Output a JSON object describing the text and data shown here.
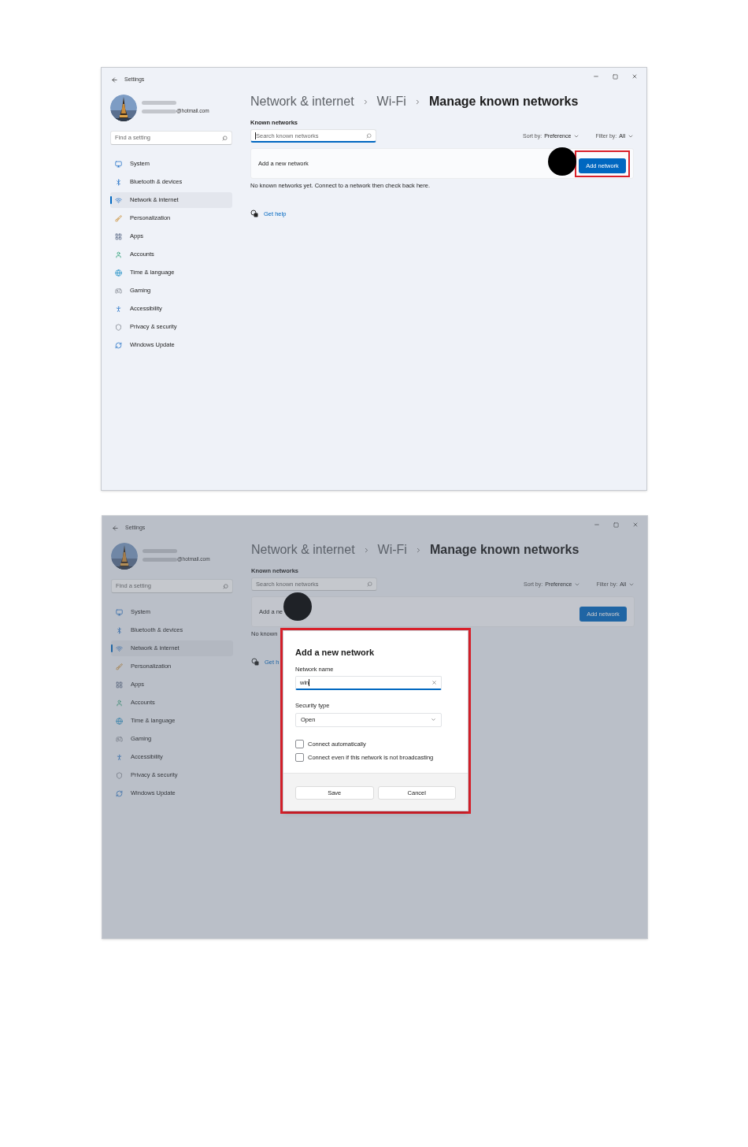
{
  "screenshots": [
    {
      "window": {
        "title": "Settings"
      },
      "account": {
        "email": "@hotmail.com"
      },
      "find_setting": {
        "placeholder": "Find a setting"
      },
      "nav": [
        {
          "label": "System",
          "selected": false
        },
        {
          "label": "Bluetooth & devices",
          "selected": false
        },
        {
          "label": "Network & internet",
          "selected": true
        },
        {
          "label": "Personalization",
          "selected": false
        },
        {
          "label": "Apps",
          "selected": false
        },
        {
          "label": "Accounts",
          "selected": false
        },
        {
          "label": "Time & language",
          "selected": false
        },
        {
          "label": "Gaming",
          "selected": false
        },
        {
          "label": "Accessibility",
          "selected": false
        },
        {
          "label": "Privacy & security",
          "selected": false
        },
        {
          "label": "Windows Update",
          "selected": false
        }
      ],
      "breadcrumb": [
        "Network & internet",
        "Wi-Fi",
        "Manage known networks"
      ],
      "section_title": "Known networks",
      "network_search": {
        "placeholder": "Search known networks",
        "focused": true
      },
      "sort": {
        "label": "Sort by:",
        "value": "Preference"
      },
      "filter": {
        "label": "Filter by:",
        "value": "All"
      },
      "add_row": {
        "label": "Add a new network",
        "button": "Add network",
        "button_highlighted": true,
        "button_marker": true
      },
      "empty_message": "No known networks yet. Connect to a network then check back here.",
      "help_link": "Get help",
      "dimmed": false
    },
    {
      "window": {
        "title": "Settings"
      },
      "account": {
        "email": "@hotmail.com"
      },
      "find_setting": {
        "placeholder": "Find a setting"
      },
      "nav": [
        {
          "label": "System",
          "selected": false
        },
        {
          "label": "Bluetooth & devices",
          "selected": false
        },
        {
          "label": "Network & internet",
          "selected": true
        },
        {
          "label": "Personalization",
          "selected": false
        },
        {
          "label": "Apps",
          "selected": false
        },
        {
          "label": "Accounts",
          "selected": false
        },
        {
          "label": "Time & language",
          "selected": false
        },
        {
          "label": "Gaming",
          "selected": false
        },
        {
          "label": "Accessibility",
          "selected": false
        },
        {
          "label": "Privacy & security",
          "selected": false
        },
        {
          "label": "Windows Update",
          "selected": false
        }
      ],
      "breadcrumb": [
        "Network & internet",
        "Wi-Fi",
        "Manage known networks"
      ],
      "section_title": "Known networks",
      "network_search": {
        "placeholder": "Search known networks",
        "focused": false
      },
      "sort": {
        "label": "Sort by:",
        "value": "Preference"
      },
      "filter": {
        "label": "Filter by:",
        "value": "All"
      },
      "add_row": {
        "label": "Add a ne",
        "button": "Add network",
        "label_marker": true
      },
      "empty_message": "No known",
      "help_link": "Get h",
      "dimmed": true,
      "dialog": {
        "title": "Add a new network",
        "highlighted": true,
        "name_label": "Network name",
        "name_value": "win",
        "security_label": "Security type",
        "security_value": "Open",
        "options": [
          {
            "label": "Connect automatically",
            "checked": false
          },
          {
            "label": "Connect even if this network is not broadcasting",
            "checked": false
          }
        ],
        "buttons": [
          "Save",
          "Cancel"
        ]
      }
    }
  ]
}
